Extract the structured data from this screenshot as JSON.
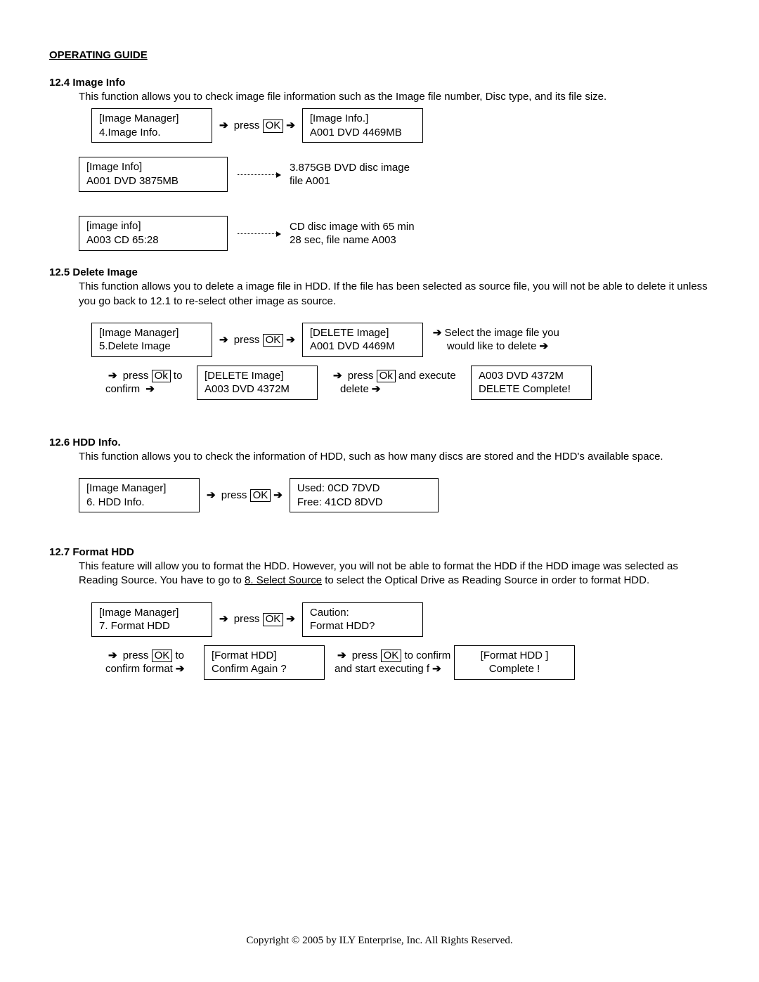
{
  "title": "OPERATING GUIDE",
  "s124": {
    "head": "12.4  Image Info",
    "text": "This function allows you to check image file information such as the Image file number, Disc type, and its file size.",
    "box1a": "[Image Manager]",
    "box1b": "4.Image Info.",
    "press": " press ",
    "ok": "OK",
    "box2a": "[Image Info.]",
    "box2b": "A001 DVD 4469MB",
    "box3a": "[Image Info]",
    "box3b": "A001  DVD      3875MB",
    "note3a": "3.875GB DVD disc image",
    "note3b": "file A001",
    "box4a": "[image info]",
    "box4b": "A003  CD           65:28",
    "note4a": "CD disc image with 65 min",
    "note4b": "28 sec, file name A003"
  },
  "s125": {
    "head": "12.5 Delete Image",
    "text": "This function allows you to delete a image file in HDD. If the file has been selected as source file, you will not be able to delete it unless you go back to 12.1 to re-select other image as source.",
    "box1a": "[Image Manager]",
    "box1b": "5.Delete Image",
    "press": " press ",
    "ok": "OK",
    "box2a": "[DELETE Image]",
    "box2b": "A001 DVD 4469M",
    "note2a": "Select  the  image  file  you",
    "note2b": "would like to delete",
    "r2_pre": "   press  ",
    "r2_ok": "Ok",
    "r2_post": "  to",
    "r2_conf": "confirm ",
    "box3a": "[DELETE Image]",
    "box3b": "A003 DVD 4372M",
    "r2_exec1": " press ",
    "r2_exec_ok": "Ok",
    "r2_exec2": " and execute",
    "r2_exec3": "delete",
    "box4a": "A003 DVD  4372M",
    "box4b": "DELETE Complete!"
  },
  "s126": {
    "head": "12.6 HDD Info.",
    "text": "This function allows you to check the information of HDD, such as how many discs are stored and the HDD's available space.",
    "box1a": "[Image Manager]",
    "box1b": "6. HDD Info.",
    "press": " press ",
    "ok": "OK",
    "box2a": "Used:   0CD   7DVD",
    "box2b": "Free:  41CD   8DVD"
  },
  "s127": {
    "head": "12.7 Format HDD",
    "text_a": "This feature will allow you to format the HDD.  However, you will not be able to format the HDD if the HDD image was selected as Reading Source. You have to go to ",
    "text_link": "8. Select Source",
    "text_b": " to select the Optical Drive as Reading Source in order to format HDD.",
    "box1a": "[Image Manager]",
    "box1b": "7. Format HDD",
    "press": " press ",
    "ok": "OK",
    "box2a": "Caution:",
    "box2b": "   Format HDD?",
    "r2_pre": "   press   ",
    "r2_ok": "OK",
    "r2_post": "   to",
    "r2_conf": "confirm format",
    "box3a": "[Format HDD]",
    "box3b": "Confirm Again ?",
    "r2_exec1": " press ",
    "r2_exec_ok": "OK",
    "r2_exec2": " to confirm",
    "r2_exec3": "and start executing f",
    "box4a": "[Format HDD ]",
    "box4b": "Complete !"
  },
  "footer": "Copyright © 2005 by ILY Enterprise, Inc. All Rights Reserved."
}
